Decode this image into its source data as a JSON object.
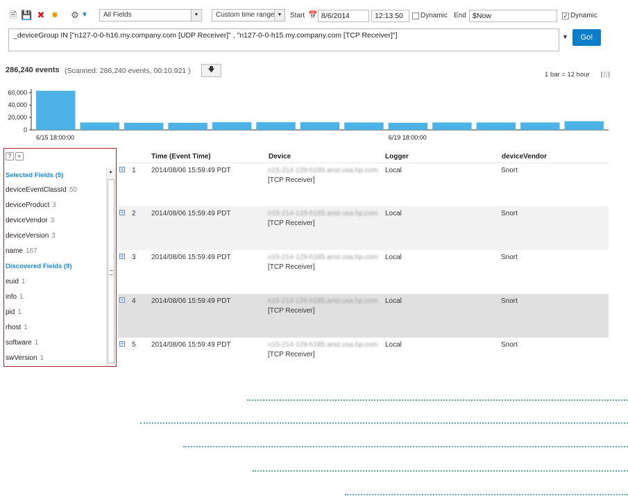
{
  "toolbar": {
    "field_set": "All Fields",
    "time_range": "Custom time range",
    "start_label": "Start",
    "start_date": "8/6/2014",
    "start_time": "12:13:50",
    "dynamic_label": "Dynamic",
    "end_label": "End",
    "end_value": "$Now",
    "end_dynamic_label": "Dynamic"
  },
  "query": {
    "text": "_deviceGroup IN [\"n127-0-0-h16.my.company.com [UDP Receiver]\" , \"n127-0-0-h15.my.company.com [TCP Receiver]\"]",
    "go_label": "Go!"
  },
  "summary": {
    "events": "286,240 events",
    "scanned": "(Scanned: 286,240 events,  00:10.921 )",
    "bar_scale": "1 bar = 12 hour"
  },
  "chart_data": {
    "type": "bar",
    "y_ticks": [
      "60,000",
      "40,000",
      "20,000",
      "0"
    ],
    "x_ticks": [
      "6/15 18:00:00",
      "6/19 18:00:00"
    ],
    "values": [
      63000,
      12000,
      11500,
      11500,
      12500,
      12500,
      12500,
      12000,
      11500,
      12000,
      12000,
      12000,
      14000
    ],
    "ylim": [
      0,
      66000
    ],
    "bar_color": "#4db3e6"
  },
  "fields_panel": {
    "selected_title": "Selected Fields (5)",
    "selected": [
      {
        "name": "deviceEventClassId",
        "count": "50"
      },
      {
        "name": "deviceProduct",
        "count": "3"
      },
      {
        "name": "deviceVendor",
        "count": "3"
      },
      {
        "name": "deviceVersion",
        "count": "3"
      },
      {
        "name": "name",
        "count": "167"
      }
    ],
    "discovered_title": "Discovered Fields (9)",
    "discovered": [
      {
        "name": "euid",
        "count": "1"
      },
      {
        "name": "info",
        "count": "1"
      },
      {
        "name": "pid",
        "count": "1"
      },
      {
        "name": "rhost",
        "count": "1"
      },
      {
        "name": "software",
        "count": "1"
      },
      {
        "name": "swVersion",
        "count": "1"
      }
    ]
  },
  "table": {
    "headers": [
      "Time (Event Time)",
      "Device",
      "Logger",
      "deviceVendor"
    ],
    "rows": [
      {
        "num": "1",
        "time": "2014/08/06 15:59:49 PDT",
        "device": "n15-214-129-h185.anst.usa.hp.com",
        "receiver": "[TCP Receiver]",
        "logger": "Local",
        "vendor": "Snort"
      },
      {
        "num": "2",
        "time": "2014/08/06 15:59:49 PDT",
        "device": "n15-214-129-h185.anst.usa.hp.com",
        "receiver": "[TCP Receiver]",
        "logger": "Local",
        "vendor": "Snort"
      },
      {
        "num": "3",
        "time": "2014/08/06 15:59:49 PDT",
        "device": "n15-214-129-h185.anst.usa.hp.com",
        "receiver": "[TCP Receiver]",
        "logger": "Local",
        "vendor": "Snort"
      },
      {
        "num": "4",
        "time": "2014/08/06 15:59:49 PDT",
        "device": "n15-214-129-h185.anst.usa.hp.com",
        "receiver": "[TCP Receiver]",
        "logger": "Local",
        "vendor": "Snort"
      },
      {
        "num": "5",
        "time": "2014/08/06 15:59:49 PDT",
        "device": "n15-214-129-h185.anst.usa.hp.com",
        "receiver": "[TCP Receiver]",
        "logger": "Local",
        "vendor": "Snort"
      }
    ]
  },
  "colors": {
    "accent": "#1b8ad1",
    "go_button": "#0e7ecb",
    "highlight_border": "#b5242c",
    "dots": "#5aa9a6"
  }
}
